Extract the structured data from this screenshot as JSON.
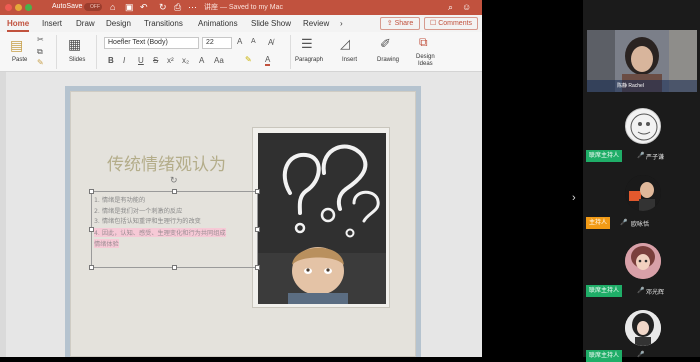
{
  "titlebar": {
    "autosave_label": "AutoSave",
    "autosave_state": "OFF",
    "document_title": "讲座 — Saved to my Mac",
    "colors": {
      "bar": "#c1523e"
    }
  },
  "tabs": [
    {
      "label": "Home"
    },
    {
      "label": "Insert"
    },
    {
      "label": "Draw"
    },
    {
      "label": "Design"
    },
    {
      "label": "Transitions"
    },
    {
      "label": "Animations"
    },
    {
      "label": "Slide Show"
    },
    {
      "label": "Review"
    }
  ],
  "share_label": "Share",
  "comments_label": "Comments",
  "ribbon": {
    "paste": "Paste",
    "slides": "Slides",
    "font_name": "Hoefler Text (Body)",
    "font_size": "22",
    "paragraph": "Paragraph",
    "insert": "Insert",
    "drawing": "Drawing",
    "design_ideas_1": "Design",
    "design_ideas_2": "Ideas",
    "bold": "B",
    "italic": "I",
    "underline": "U",
    "strike": "S",
    "font_increase": "A",
    "font_decrease": "A"
  },
  "slide": {
    "title": "传统情绪观认为",
    "bullets": [
      "1. 情绪是有功能的",
      "2. 情绪是我们对一个刺激的反应",
      "3. 情绪包括认知重评和生理行为的改变",
      "4. 因此，认知、感受、生理变化和行为共同组成",
      "情绪体验"
    ]
  },
  "meeting": {
    "speaker_name": "陈静 Rachel",
    "participants": [
      {
        "badge": "联席主持人",
        "name": "严子谦",
        "badge_color": "#1fae68"
      },
      {
        "badge": "主持人",
        "name": "欧咏恬",
        "badge_color": "#f29b16"
      },
      {
        "badge": "联席主持人",
        "name": "邓光辉",
        "badge_color": "#1fae68"
      },
      {
        "badge": "联席主持人",
        "name": "",
        "badge_color": "#1fae68"
      }
    ]
  }
}
